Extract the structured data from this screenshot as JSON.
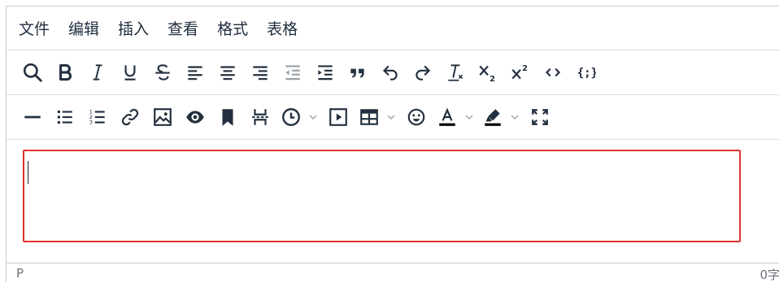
{
  "menubar": {
    "items": [
      "文件",
      "编辑",
      "插入",
      "查看",
      "格式",
      "表格"
    ]
  },
  "toolbar_row1": [
    {
      "name": "search-icon"
    },
    {
      "name": "bold-icon"
    },
    {
      "name": "italic-icon"
    },
    {
      "name": "underline-icon"
    },
    {
      "name": "strikethrough-icon"
    },
    {
      "name": "align-left-icon"
    },
    {
      "name": "align-center-icon"
    },
    {
      "name": "align-right-icon"
    },
    {
      "name": "outdent-icon"
    },
    {
      "name": "indent-icon"
    },
    {
      "name": "blockquote-icon"
    },
    {
      "name": "undo-icon"
    },
    {
      "name": "redo-icon"
    },
    {
      "name": "clear-formatting-icon"
    },
    {
      "name": "subscript-icon"
    },
    {
      "name": "superscript-icon"
    },
    {
      "name": "source-code-icon"
    },
    {
      "name": "code-sample-icon"
    }
  ],
  "toolbar_row2": [
    {
      "name": "horizontal-line-icon"
    },
    {
      "name": "bullet-list-icon"
    },
    {
      "name": "numbered-list-icon"
    },
    {
      "name": "link-icon"
    },
    {
      "name": "image-icon"
    },
    {
      "name": "preview-icon"
    },
    {
      "name": "bookmark-icon"
    },
    {
      "name": "page-break-icon"
    },
    {
      "name": "insert-datetime-icon"
    },
    {
      "name": "media-icon"
    },
    {
      "name": "table-icon"
    },
    {
      "name": "emoticons-icon"
    },
    {
      "name": "text-color-icon"
    },
    {
      "name": "highlight-color-icon"
    },
    {
      "name": "fullscreen-icon"
    }
  ],
  "colors": {
    "icon": "#222f3e",
    "disabled_icon": "#9aa0a6",
    "focus_border": "#e03131",
    "border": "#cccccc"
  },
  "statusbar": {
    "path": "P",
    "word_count": "0字"
  }
}
